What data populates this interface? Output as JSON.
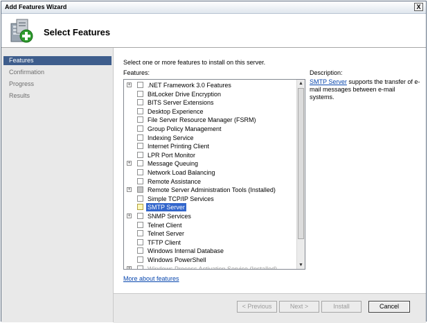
{
  "window": {
    "title": "Add Features Wizard",
    "close_label": "X"
  },
  "header": {
    "title": "Select Features",
    "icon": "server-add-icon"
  },
  "nav": {
    "items": [
      "Features",
      "Confirmation",
      "Progress",
      "Results"
    ],
    "selected_index": 0
  },
  "main": {
    "instruction": "Select one or more features to install on this server.",
    "features_label": "Features:",
    "description_label": "Description:",
    "description_link": "SMTP Server",
    "description_rest": " supports the transfer of e-mail messages between e-mail systems.",
    "more_link": "More about features"
  },
  "features": [
    {
      "label": ".NET Framework 3.0 Features",
      "expandable": true,
      "state": "unchecked"
    },
    {
      "label": "BitLocker Drive Encryption",
      "expandable": false,
      "state": "unchecked"
    },
    {
      "label": "BITS Server Extensions",
      "expandable": false,
      "state": "unchecked"
    },
    {
      "label": "Desktop Experience",
      "expandable": false,
      "state": "unchecked"
    },
    {
      "label": "File Server Resource Manager (FSRM)",
      "expandable": false,
      "state": "unchecked"
    },
    {
      "label": "Group Policy Management",
      "expandable": false,
      "state": "unchecked"
    },
    {
      "label": "Indexing Service",
      "expandable": false,
      "state": "unchecked"
    },
    {
      "label": "Internet Printing Client",
      "expandable": false,
      "state": "unchecked"
    },
    {
      "label": "LPR Port Monitor",
      "expandable": false,
      "state": "unchecked"
    },
    {
      "label": "Message Queuing",
      "expandable": true,
      "state": "unchecked"
    },
    {
      "label": "Network Load Balancing",
      "expandable": false,
      "state": "unchecked"
    },
    {
      "label": "Remote Assistance",
      "expandable": false,
      "state": "unchecked"
    },
    {
      "label": "Remote Server Administration Tools  (Installed)",
      "expandable": true,
      "state": "partial"
    },
    {
      "label": "Simple TCP/IP Services",
      "expandable": false,
      "state": "unchecked"
    },
    {
      "label": "SMTP Server",
      "expandable": false,
      "state": "highlighted",
      "selected": true
    },
    {
      "label": "SNMP Services",
      "expandable": true,
      "state": "unchecked"
    },
    {
      "label": "Telnet Client",
      "expandable": false,
      "state": "unchecked"
    },
    {
      "label": "Telnet Server",
      "expandable": false,
      "state": "unchecked"
    },
    {
      "label": "TFTP Client",
      "expandable": false,
      "state": "unchecked"
    },
    {
      "label": "Windows Internal Database",
      "expandable": false,
      "state": "unchecked"
    },
    {
      "label": "Windows PowerShell",
      "expandable": false,
      "state": "unchecked"
    },
    {
      "label": "Windows Process Activation Service  (Installed)",
      "expandable": true,
      "state": "disabled"
    }
  ],
  "buttons": {
    "previous": "< Previous",
    "next": "Next >",
    "install": "Install",
    "cancel": "Cancel"
  },
  "colors": {
    "selection": "#3366cc",
    "nav_selected": "#3e5d8c",
    "link": "#0645ad"
  }
}
